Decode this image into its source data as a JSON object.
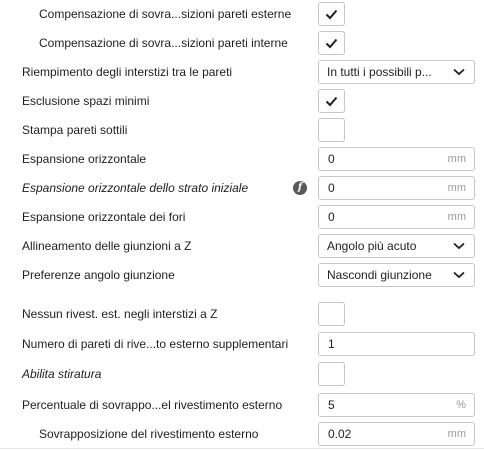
{
  "settings": {
    "row0": {
      "label": "Compensazione di sovra...sizioni pareti esterne",
      "checked": true
    },
    "row1": {
      "label": "Compensazione di sovra...sizioni pareti interne",
      "checked": true
    },
    "row2": {
      "label": "Riempimento degli interstizi tra le pareti",
      "value": "In tutti i possibili p..."
    },
    "row3": {
      "label": "Esclusione spazi minimi",
      "checked": true
    },
    "row4": {
      "label": "Stampa pareti sottili",
      "checked": false
    },
    "row5": {
      "label": "Espansione orizzontale",
      "value": "0",
      "unit": "mm"
    },
    "row6": {
      "label": "Espansione orizzontale dello strato iniziale",
      "value": "0",
      "unit": "mm",
      "hint_icon": "f-function-icon"
    },
    "row7": {
      "label": "Espansione orizzontale dei fori",
      "value": "0",
      "unit": "mm"
    },
    "row8": {
      "label": "Allineamento delle giunzioni a Z",
      "value": "Angolo più acuto"
    },
    "row9": {
      "label": "Preferenze angolo giunzione",
      "value": "Nascondi giunzione"
    },
    "row10": {
      "label": "Nessun rivest. est. negli interstizi a Z",
      "checked": false
    },
    "row11": {
      "label": "Numero di pareti di rive...to esterno supplementari",
      "value": "1"
    },
    "row12": {
      "label": "Abilita stiratura",
      "checked": false
    },
    "row13": {
      "label": "Percentuale di sovrappo...el rivestimento esterno",
      "value": "5",
      "unit": "%"
    },
    "row14": {
      "label": "Sovrapposizione del rivestimento esterno",
      "value": "0.02",
      "unit": "mm"
    }
  },
  "colors": {
    "text": "#1f1f1f",
    "border": "#c7c7c7",
    "unit": "#9a9a9a",
    "background": "#ffffff"
  }
}
